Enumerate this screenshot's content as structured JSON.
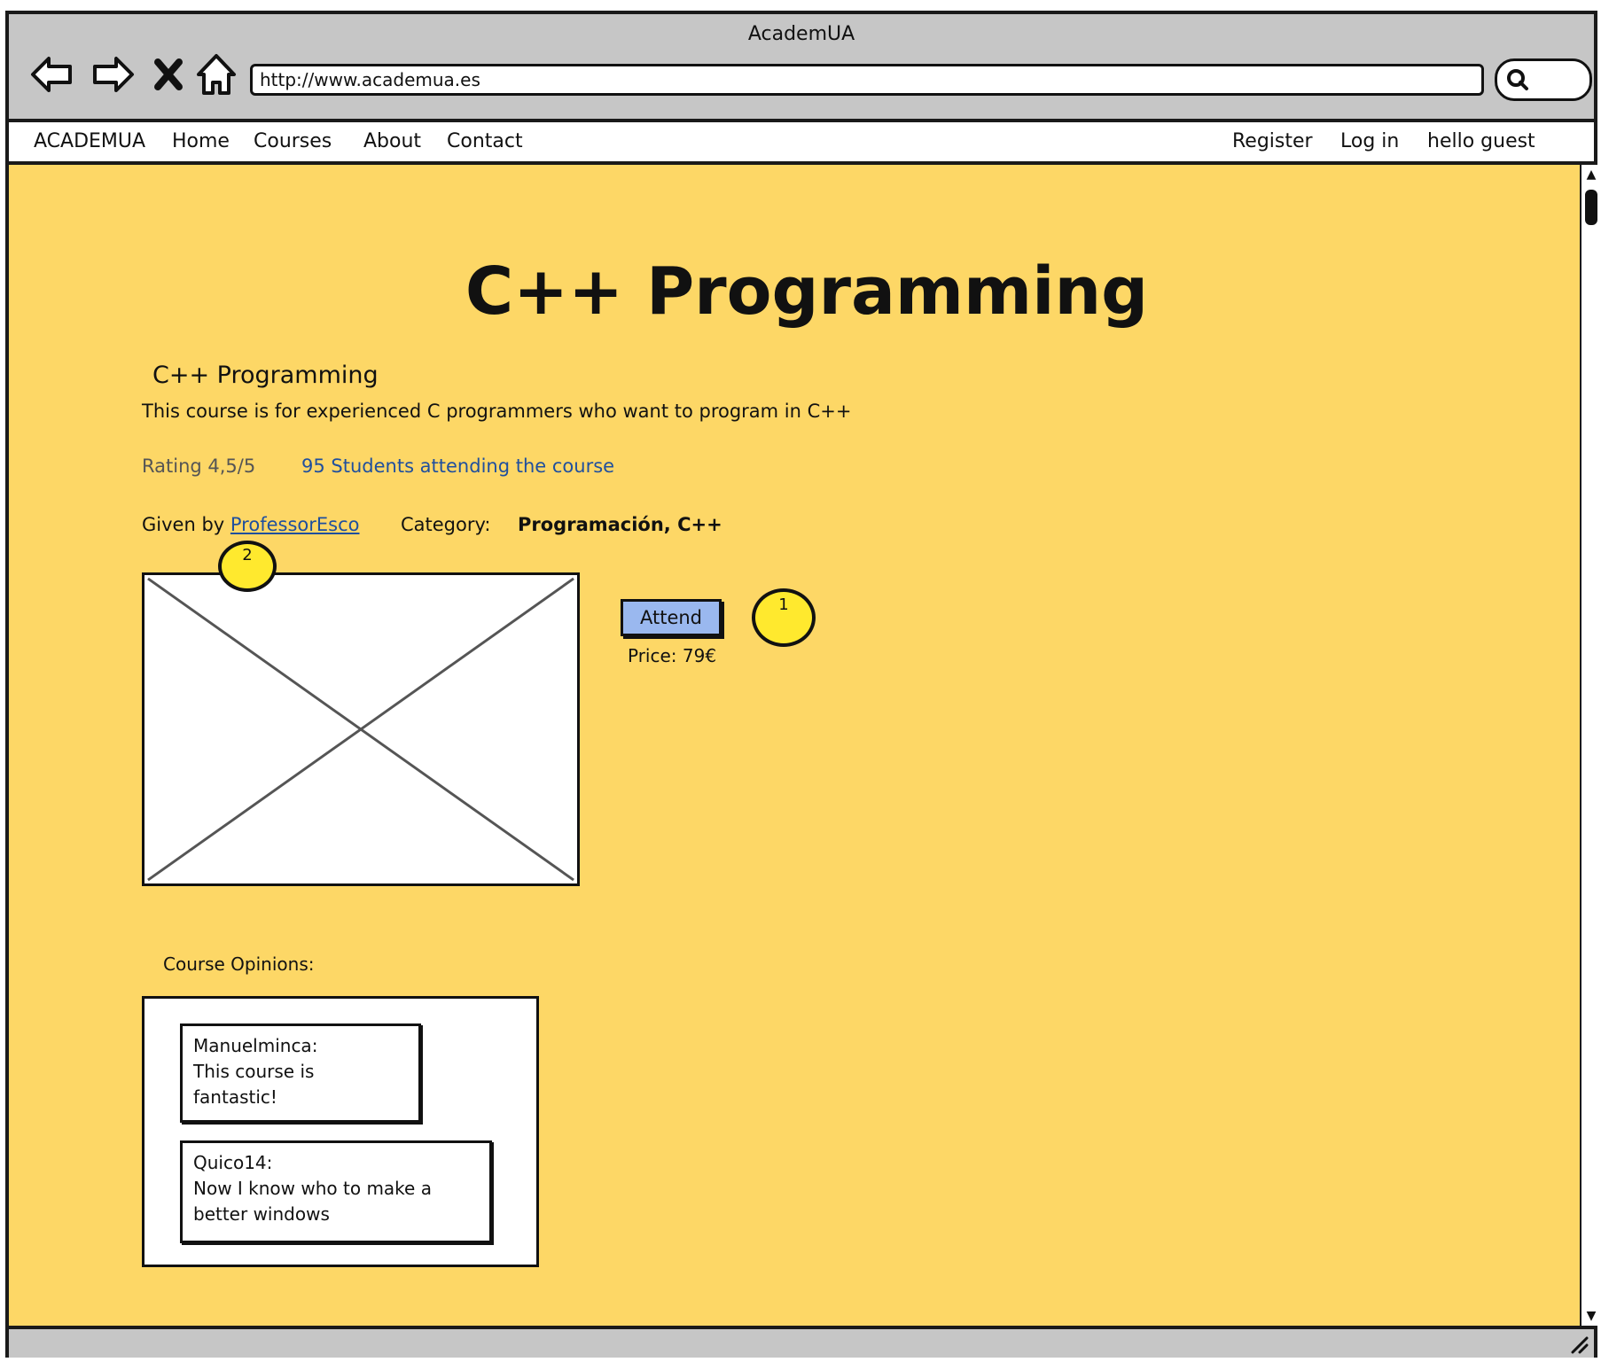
{
  "window": {
    "title": "AcademUA"
  },
  "browser": {
    "url": "http://www.academua.es",
    "icons": [
      "back-arrow-icon",
      "forward-arrow-icon",
      "close-icon",
      "home-icon",
      "search-icon"
    ]
  },
  "menu": {
    "brand": "ACADEMUA",
    "items": [
      "Home",
      "Courses",
      "About",
      "Contact"
    ],
    "right": [
      "Register",
      "Log in",
      "hello guest"
    ]
  },
  "course": {
    "heading": "C++ Programming",
    "subtitle": "C++ Programming",
    "description": "This course is for experienced C programmers who want to program in C++",
    "rating": "Rating 4,5/5",
    "students": "95 Students attending the course",
    "given_by_label": "Given by",
    "professor": "ProfessorEsco",
    "category_label": "Category:",
    "category_value": "Programación, C++",
    "attend_label": "Attend",
    "price": "Price: 79€"
  },
  "markers": {
    "m1": "1",
    "m2": "2"
  },
  "opinions": {
    "label": "Course Opinions:",
    "items": [
      {
        "author": "Manuelminca:",
        "lines": [
          "This course is",
          "fantastic!"
        ]
      },
      {
        "author": "Quico14:",
        "lines": [
          "Now I know who to make a",
          "better windows"
        ]
      }
    ]
  },
  "colors": {
    "content_bg": "#fdd766",
    "chrome_bg": "#c6c6c6",
    "link": "#1f4f9e",
    "button_bg": "#9ab8ef",
    "marker": "#ffe92e"
  }
}
